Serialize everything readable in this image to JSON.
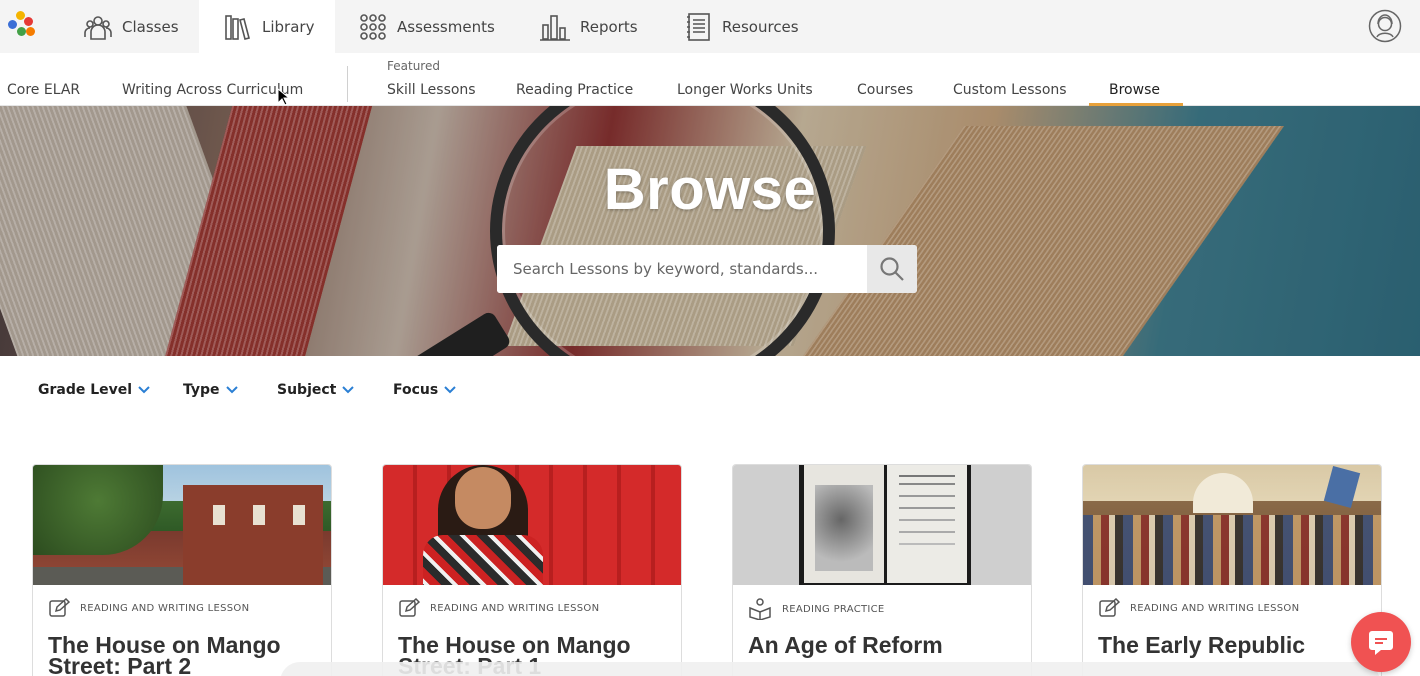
{
  "topnav": {
    "items": [
      {
        "label": "Classes",
        "icon": "classes-icon"
      },
      {
        "label": "Library",
        "icon": "library-icon",
        "active": true
      },
      {
        "label": "Assessments",
        "icon": "assessments-icon"
      },
      {
        "label": "Reports",
        "icon": "reports-icon"
      },
      {
        "label": "Resources",
        "icon": "resources-icon"
      }
    ],
    "profile_icon": "profile-avatar-icon"
  },
  "subnav": {
    "items": [
      "Core ELAR",
      "Writing Across Curriculum",
      "Skill Lessons",
      "Reading Practice",
      "Longer Works Units",
      "Courses",
      "Custom Lessons",
      "Browse"
    ],
    "featured_label": "Featured",
    "active": "Browse",
    "accent": "#e8a13a"
  },
  "hero": {
    "title": "Browse",
    "search_placeholder": "Search Lessons by keyword, standards..."
  },
  "filters": [
    "Grade Level",
    "Type",
    "Subject",
    "Focus"
  ],
  "cards": [
    {
      "type": "READING AND WRITING LESSON",
      "title": "The House on Mango Street: Part 2",
      "icon": "edit-note-icon"
    },
    {
      "type": "READING AND WRITING LESSON",
      "title": "The House on Mango Street: Part 1",
      "icon": "edit-note-icon"
    },
    {
      "type": "READING PRACTICE",
      "title": "An Age of Reform",
      "icon": "reading-person-icon"
    },
    {
      "type": "READING AND WRITING LESSON",
      "title": "The Early Republic",
      "icon": "edit-note-icon"
    }
  ],
  "colors": {
    "accent_blue": "#2a7fd4",
    "chat": "#f05252"
  }
}
